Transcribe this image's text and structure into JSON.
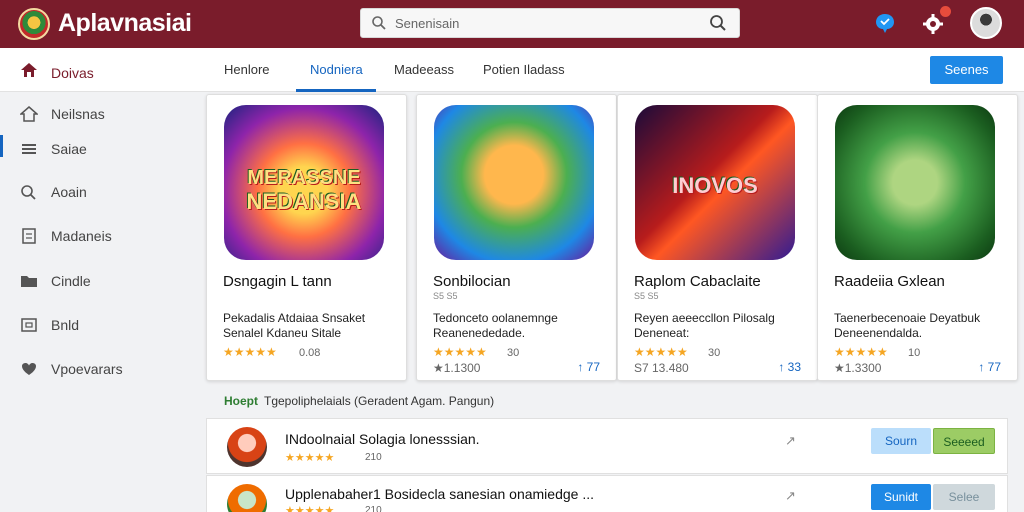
{
  "app": {
    "title": "Aplavnasiai"
  },
  "search": {
    "placeholder": "Senenisain"
  },
  "header": {
    "home_label": "Doivas",
    "tabs": [
      {
        "label": "Henlore"
      },
      {
        "label": "Nodniera"
      },
      {
        "label": "Madeeass"
      },
      {
        "label": "Potien Iladass"
      }
    ],
    "primary_button": "Seenes"
  },
  "sidebar": {
    "items": [
      {
        "label": "Neilsnas",
        "icon": "home-outline-icon"
      },
      {
        "label": "Saiae",
        "icon": "list-icon"
      },
      {
        "label": "Aoain",
        "icon": "search-icon"
      },
      {
        "label": "Madaneis",
        "icon": "document-icon"
      },
      {
        "label": "Cindle",
        "icon": "folder-icon"
      },
      {
        "label": "Bnld",
        "icon": "box-icon"
      },
      {
        "label": "Vpoevarars",
        "icon": "heart-icon"
      }
    ]
  },
  "cards": [
    {
      "art_text_1": "MERASSNE",
      "art_text_2": "NEDANSIA",
      "title": "Dsngagin L tann",
      "subtitle": "",
      "desc_1": "Pekadalis Atdaiaa Snsaket",
      "desc_2": "Senalel Kdaneu Sitale",
      "stars": "★★★★★",
      "rating": "0.08",
      "downloads": "",
      "updates": ""
    },
    {
      "art_text_1": "",
      "art_text_2": "",
      "title": "Sonbilocian",
      "subtitle": "S5 S5",
      "desc_1": "Tedonceto oolanemnge",
      "desc_2": "Reanenededade.",
      "stars": "★★★★★",
      "rating": "30",
      "downloads": "★1.1300",
      "updates": "↑ 77"
    },
    {
      "art_text_1": "INOVOS",
      "art_text_2": "",
      "title": "Raplom Cabaclaite",
      "subtitle": "S5 S5",
      "desc_1": "Reyen aeeeccllon Pilosalg",
      "desc_2": "Deneneat:",
      "stars": "★★★★★",
      "rating": "30",
      "downloads": "S7 13.480",
      "updates": "↑ 33"
    },
    {
      "art_text_1": "",
      "art_text_2": "",
      "title": "Raadeiia Gxlean",
      "subtitle": "",
      "desc_1": "Taenerbecenoaie Deyatbuk",
      "desc_2": "Deneenendalda.",
      "stars": "★★★★★",
      "rating": "10",
      "downloads": "★1.3300",
      "updates": "↑ 77"
    }
  ],
  "section": {
    "highlight": "Hoept",
    "title": "Tgepoliphelaials (Geradent Agam. Pangun)"
  },
  "rows": [
    {
      "title": "INdoolnaial Solagia lonesssian.",
      "stars": "★★★★★",
      "count": "210",
      "button_a": "Sourn",
      "button_b": "Seeeed"
    },
    {
      "title": "Upplenabaher1 Bosidecla sanesian onamiedge ...",
      "stars": "★★★★★",
      "count": "210",
      "button_a": "Sunidt",
      "button_b": "Selee"
    }
  ],
  "colors": {
    "header_bg": "#7a1c2b",
    "accent_blue": "#1565c0",
    "primary_button": "#1e88e5",
    "star": "#f5a623",
    "green_button": "#9ccc65"
  }
}
